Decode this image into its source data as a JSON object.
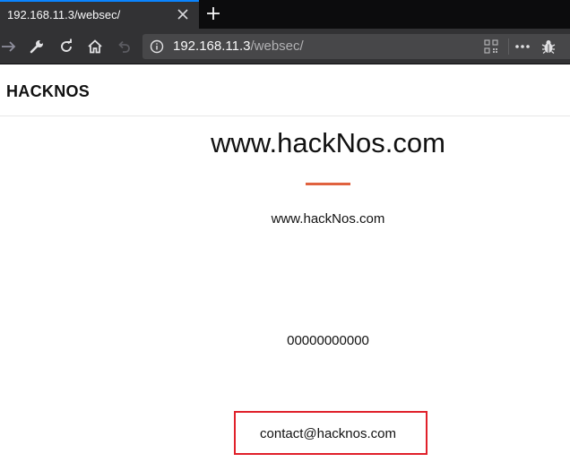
{
  "browser": {
    "tab": {
      "title": "192.168.11.3/websec/"
    },
    "url": {
      "host": "192.168.11.3",
      "path": "/websec/"
    }
  },
  "page": {
    "brand": "HACKNOS",
    "hero_title": "www.hackNos.com",
    "site": "www.hackNos.com",
    "phone": "00000000000",
    "email": "contact@hacknos.com"
  },
  "colors": {
    "accent_line": "#e0623f",
    "highlight_box": "#e0202a",
    "tab_indicator": "#0a84ff"
  }
}
